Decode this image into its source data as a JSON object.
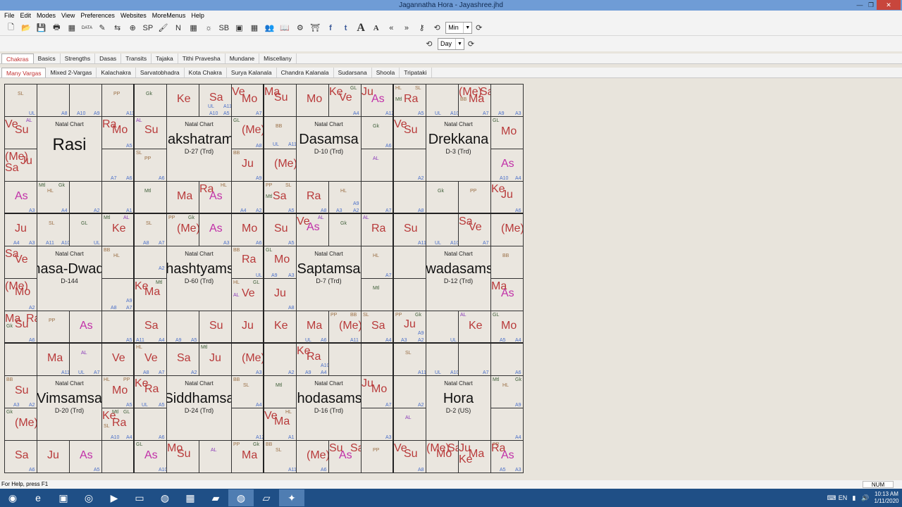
{
  "window": {
    "title": "Jagannatha Hora - Jayashree.jhd",
    "min": "—",
    "max": "❐",
    "close": "✕"
  },
  "menu": [
    "File",
    "Edit",
    "Modes",
    "View",
    "Preferences",
    "Websites",
    "MoreMenus",
    "Help"
  ],
  "toolbar": {
    "icons": [
      {
        "name": "new-file-icon",
        "glyph": "🗋"
      },
      {
        "name": "open-folder-icon",
        "glyph": "📂"
      },
      {
        "name": "save-icon",
        "glyph": "💾"
      },
      {
        "name": "print-icon",
        "glyph": "🖶"
      },
      {
        "name": "chart-data-icon",
        "glyph": "▦"
      },
      {
        "name": "data-entry-icon",
        "glyph": "DATA"
      },
      {
        "name": "transit-edit-icon",
        "glyph": "✎"
      },
      {
        "name": "transfer-icon",
        "glyph": "⇆"
      },
      {
        "name": "cycle-icon",
        "glyph": "⊕"
      },
      {
        "name": "sp-kh-icon",
        "glyph": "SP"
      },
      {
        "name": "brush-icon",
        "glyph": "🖌"
      },
      {
        "name": "notes-icon",
        "glyph": "N"
      },
      {
        "name": "grid-icon",
        "glyph": "▦"
      },
      {
        "name": "sun-icon",
        "glyph": "☼"
      },
      {
        "name": "sb-icon",
        "glyph": "SB"
      },
      {
        "name": "frame-icon",
        "glyph": "▣"
      },
      {
        "name": "table-icon",
        "glyph": "▦"
      },
      {
        "name": "people-icon",
        "glyph": "👥"
      },
      {
        "name": "book-icon",
        "glyph": "📖"
      },
      {
        "name": "gears-icon",
        "glyph": "⚙"
      },
      {
        "name": "temple-icon",
        "glyph": "⛩"
      },
      {
        "name": "facebook-icon",
        "glyph": "f"
      },
      {
        "name": "twitter-icon",
        "glyph": "t"
      },
      {
        "name": "font-large-icon",
        "glyph": "A"
      },
      {
        "name": "font-small-icon",
        "glyph": "A"
      },
      {
        "name": "back-icon",
        "glyph": "«"
      },
      {
        "name": "forward-icon",
        "glyph": "»"
      },
      {
        "name": "key-icon",
        "glyph": "⚷"
      },
      {
        "name": "step-back-icon",
        "glyph": "⟲"
      }
    ],
    "step_unit": "Min",
    "step_forward_icon": "⟳"
  },
  "toolbar2": {
    "back_icon": "⟲",
    "day_unit": "Day",
    "forward_icon": "⟳"
  },
  "tabs_main": [
    "Chakras",
    "Basics",
    "Strengths",
    "Dasas",
    "Transits",
    "Tajaka",
    "Tithi Pravesha",
    "Mundane",
    "Miscellany"
  ],
  "tabs_sub": [
    "Many Vargas",
    "Mixed 2-Vargas",
    "Kalachakra",
    "Sarvatobhadra",
    "Kota Chakra",
    "Surya Kalanala",
    "Chandra Kalanala",
    "Sudarsana",
    "Shoola",
    "Tripataki"
  ],
  "colors": {
    "planet": "#b83a3a",
    "ascendant": "#c12fa8",
    "upagraha": "#9a6f45",
    "special": "#40603a",
    "arudha": "#4a6fc8",
    "lagna_arudha": "#8a3bb8"
  },
  "charts": [
    {
      "title": "Natal Chart",
      "name": "Rasi",
      "sub": "",
      "cells": [
        [
          {
            "t": "SL",
            "c": "brown",
            "x": 16,
            "y": 12
          },
          {
            "t": "UL",
            "c": "blue",
            "x": 36,
            "y": 38
          }
        ],
        [
          {
            "t": "A8",
            "c": "blue",
            "x": 34,
            "y": 38
          }
        ],
        [
          {
            "t": "A10",
            "c": "blue",
            "x": 10,
            "y": 38
          },
          {
            "t": "A9",
            "c": "blue",
            "x": 34,
            "y": 38
          }
        ],
        [
          {
            "t": "PP",
            "c": "brown",
            "x": 16,
            "y": 12
          },
          {
            "t": "A11",
            "c": "blue",
            "x": 34,
            "y": 38
          }
        ],
        [
          {
            "t": "A12",
            "c": "blue",
            "x": 34,
            "y": 38
          }
        ],
        [
          {
            "t": "AL",
            "c": "purple",
            "x": 30,
            "y": 4
          }
        ],
        [
          {
            "t": "A7",
            "c": "blue",
            "x": 12,
            "y": 40
          },
          {
            "t": "A6",
            "c": "blue",
            "x": 34,
            "y": 40
          }
        ],
        [
          {
            "t": "A3",
            "c": "blue",
            "x": 34,
            "y": 38
          }
        ],
        [
          {
            "t": "Mtl",
            "c": "green",
            "x": 2,
            "y": 2
          },
          {
            "t": "HL",
            "c": "brown",
            "x": 14,
            "y": 12
          },
          {
            "t": "Gk",
            "c": "green",
            "x": 30,
            "y": 2
          },
          {
            "t": "A4",
            "c": "blue",
            "x": 34,
            "y": 38
          }
        ],
        [
          {
            "t": "A2",
            "c": "blue",
            "x": 34,
            "y": 38
          }
        ],
        [
          {
            "t": "A1",
            "c": "blue",
            "x": 34,
            "y": 38
          }
        ]
      ],
      "planets": [
        {
          "cell": 5,
          "items": [
            {
              "t": "Ve",
              "c": "red",
              "x": 0,
              "y": 4
            },
            {
              "t": "Su",
              "c": "red",
              "x": 16,
              "y": 12
            }
          ]
        },
        {
          "cell": 3,
          "items": []
        },
        {
          "cell": 4,
          "items": [
            {
              "t": "Ra",
              "c": "red",
              "x": 0,
              "y": 4
            },
            {
              "t": "Mo",
              "c": "red",
              "x": 16,
              "y": 12
            }
          ]
        },
        {
          "cell": 6,
          "items": [
            {
              "t": "(Me)",
              "c": "red",
              "x": 0,
              "y": 4
            },
            {
              "t": "Ju",
              "c": "red",
              "x": 26,
              "y": 12
            },
            {
              "t": "Ma",
              "c": "red",
              "x": 22,
              "y": 12
            },
            {
              "t": "Sa",
              "c": "red",
              "x": 0,
              "y": 20
            }
          ]
        },
        {
          "cell": 7,
          "items": [
            {
              "t": "As",
              "c": "mag",
              "x": 14,
              "y": 12
            }
          ]
        }
      ]
    },
    {
      "title": "Natal Chart",
      "name": "Nakshatrams",
      "sub": "D-27 (Trd)"
    },
    {
      "title": "Natal Chart",
      "name": "Dasamsa",
      "sub": "D-10 (Trd)"
    },
    {
      "title": "Natal Chart",
      "name": "Drekkana",
      "sub": "D-3 (Trd)"
    },
    {
      "title": "Natal Chart",
      "name": "Bhasa-Dwadasamsa",
      "sub": "D-144"
    },
    {
      "title": "Natal Chart",
      "name": "Shashtyamsa",
      "sub": "D-60 (Trd)"
    },
    {
      "title": "Natal Chart",
      "name": "Saptamsa",
      "sub": "D-7 (Trd)"
    },
    {
      "title": "Natal Chart",
      "name": "Dwadasamsa",
      "sub": "D-12 (Trd)"
    },
    {
      "title": "Natal Chart",
      "name": "Vimsamsa",
      "sub": "D-20 (Trd)"
    },
    {
      "title": "Natal Chart",
      "name": "Siddhamsa",
      "sub": "D-24 (Trd)"
    },
    {
      "title": "Natal Chart",
      "name": "Shodasamsa",
      "sub": "D-16 (Trd)"
    },
    {
      "title": "Natal Chart",
      "name": "Hora",
      "sub": "D-2 (US)"
    }
  ],
  "status": {
    "help": "For Help, press F1",
    "num": "NUM"
  },
  "taskbar": {
    "apps": [
      "start-icon",
      "ie-icon",
      "store-icon",
      "media-icon",
      "player-icon",
      "explorer-icon",
      "chrome-icon",
      "calculator-icon",
      "folder-icon",
      "chrome-alt-icon",
      "notes-app-icon",
      "jhora-icon"
    ],
    "lang": "EN",
    "time": "10:13 AM",
    "date": "1/11/2020"
  }
}
